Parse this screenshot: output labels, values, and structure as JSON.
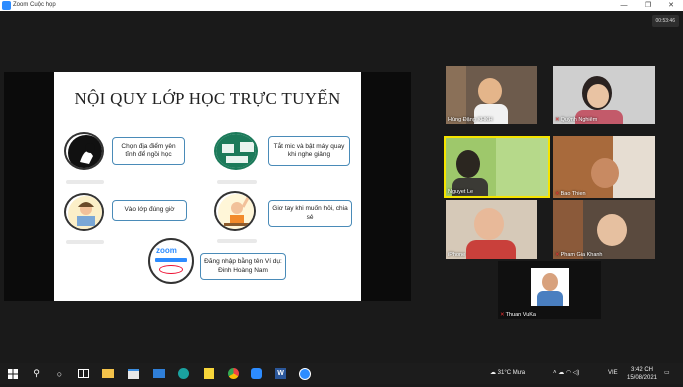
{
  "window": {
    "title": "Zoom Cuộc họp"
  },
  "meeting": {
    "timer": "00:53:46"
  },
  "slide": {
    "title": "NỘI QUY LỚP HỌC TRỰC TUYẾN",
    "rules": [
      {
        "text": "Chọn địa điểm yên tĩnh để ngồi học"
      },
      {
        "text": "Tắt mic và bật máy quay khi nghe giảng"
      },
      {
        "text": "Vào lớp đúng giờ"
      },
      {
        "text": "Giơ tay khi muốn hỏi, chia sẻ"
      },
      {
        "text": "Đăng nhập bằng tên Ví dụ: Đinh Hoàng Nam"
      }
    ],
    "zoom_logo": "zoom"
  },
  "participants": [
    {
      "name": "Hùng Đặng KHKH",
      "muted": false
    },
    {
      "name": "Quỳnh Nghiêm",
      "muted": true
    },
    {
      "name": "Nguyet Le",
      "muted": false,
      "active": true
    },
    {
      "name": "Bao Thien",
      "muted": true
    },
    {
      "name": "iPhone",
      "muted": false
    },
    {
      "name": "Pham Gia Khanh",
      "muted": true
    },
    {
      "name": "Thuan VuKa",
      "muted": true
    }
  ],
  "taskbar": {
    "weather": "31°C",
    "weather_desc": "Mưa",
    "lang": "VIE",
    "time": "3:42 CH",
    "date": "15/08/2021",
    "word_icon": "W"
  },
  "colors": {
    "accent": "#2d8cff",
    "active_border": "#f5e400",
    "muted_mic": "#e33333"
  }
}
